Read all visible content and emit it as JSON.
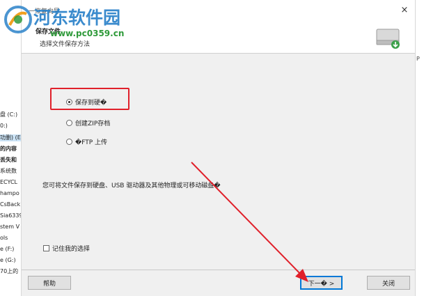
{
  "background": {
    "left_items": [
      "盘 (C:)",
      "0:)",
      "功删) (E",
      "的内容",
      "丢失和",
      "系统数",
      "ECYCL",
      "hampo",
      "CsBack",
      "Sia6339",
      "stem V",
      "ols",
      "e (F:)",
      "e (G:)",
      "70上的"
    ],
    "right_fragment": "P"
  },
  "dialog": {
    "window_title": "一恢复向导",
    "close_symbol": "×",
    "header_title": "保存文件",
    "header_subtitle": "选择文件保存方法",
    "options": [
      {
        "label": "保存到硬�",
        "checked": true
      },
      {
        "label": "创建ZIP存档",
        "checked": false
      },
      {
        "label": "�FTP 上传",
        "checked": false
      }
    ],
    "description": "您可将文件保存到硬盘、USB 驱动器及其他物理或可移动磁盘�",
    "remember_label": "记住我的选择",
    "buttons": {
      "help": "帮助",
      "next": "下一� >",
      "close": "关闭"
    }
  },
  "watermark": {
    "site_name": "河东软件园",
    "url": "www.pc0359.cn"
  },
  "colors": {
    "highlight_box": "#e0202a",
    "arrow": "#e0202a",
    "watermark_text": "#2b82c9",
    "watermark_url": "#2f9a3a"
  }
}
